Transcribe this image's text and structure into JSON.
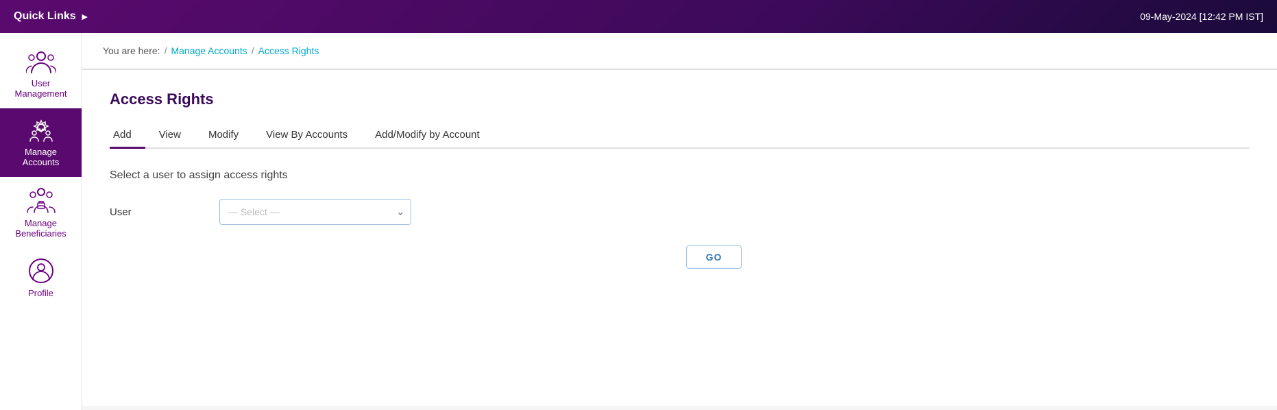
{
  "topbar": {
    "quick_links_label": "Quick Links",
    "datetime": "09-May-2024 [12:42 PM IST]"
  },
  "sidebar": {
    "items": [
      {
        "id": "user-management",
        "label": "User\nManagement",
        "active": false
      },
      {
        "id": "manage-accounts",
        "label": "Manage\nAccounts",
        "active": true
      },
      {
        "id": "manage-beneficiaries",
        "label": "Manage\nBeneficiaries",
        "active": false
      },
      {
        "id": "profile",
        "label": "Profile",
        "active": false
      }
    ]
  },
  "breadcrumb": {
    "you_are_here": "You are here:",
    "separator": "/",
    "items": [
      {
        "label": "Manage Accounts",
        "link": true
      },
      {
        "label": "Access Rights",
        "link": true
      }
    ]
  },
  "page": {
    "title": "Access Rights"
  },
  "tabs": [
    {
      "label": "Add",
      "active": true
    },
    {
      "label": "View",
      "active": false
    },
    {
      "label": "Modify",
      "active": false
    },
    {
      "label": "View By Accounts",
      "active": false
    },
    {
      "label": "Add/Modify by Account",
      "active": false
    }
  ],
  "form": {
    "section_title": "Select a user to assign access rights",
    "user_label": "User",
    "user_placeholder": "— Select —",
    "go_button": "GO"
  }
}
